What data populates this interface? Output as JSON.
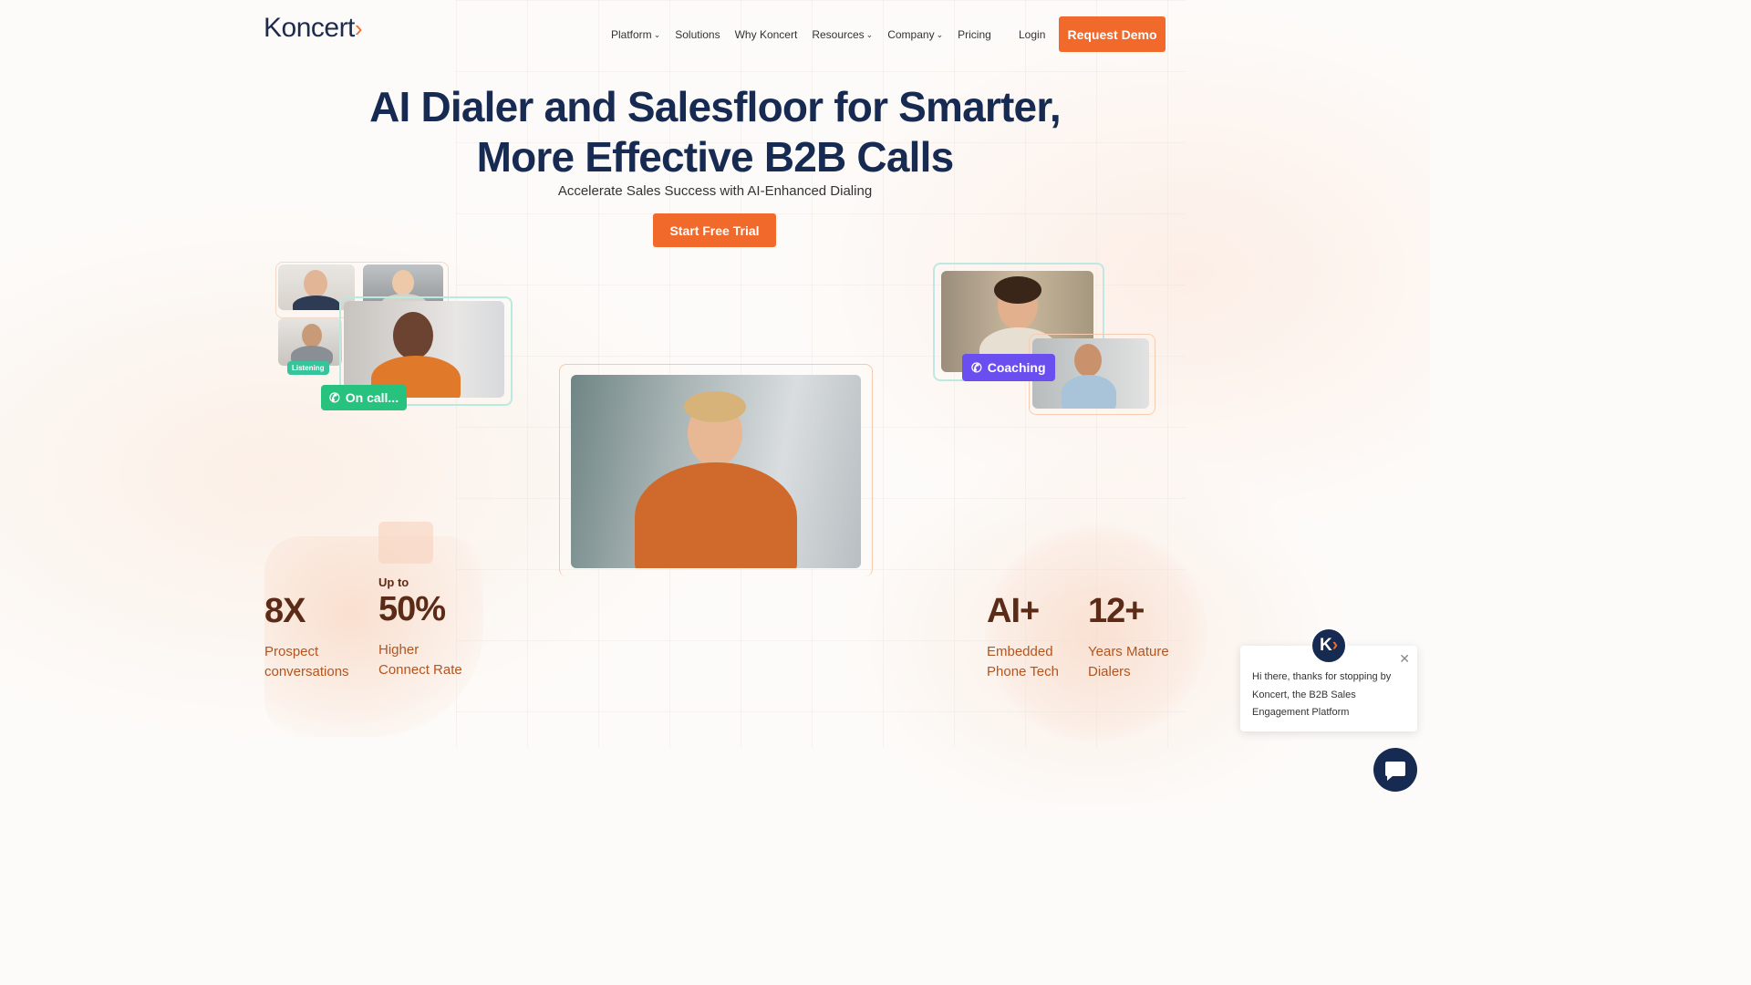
{
  "header": {
    "logo": "Koncert",
    "logo_mark": "›",
    "nav": [
      {
        "label": "Platform",
        "dropdown": true
      },
      {
        "label": "Solutions",
        "dropdown": false
      },
      {
        "label": "Why Koncert",
        "dropdown": false
      },
      {
        "label": "Resources",
        "dropdown": true
      },
      {
        "label": "Company",
        "dropdown": true
      },
      {
        "label": "Pricing",
        "dropdown": false
      }
    ],
    "login": "Login",
    "cta": "Request Demo"
  },
  "hero": {
    "title_line1": "AI Dialer and Salesfloor for Smarter,",
    "title_line2": "More Effective B2B Calls",
    "subtitle": "Accelerate Sales Success with AI-Enhanced Dialing",
    "cta": "Start Free Trial"
  },
  "visuals": {
    "left_badge": "On call...",
    "left_tag": "Listening",
    "right_badge": "Coaching"
  },
  "stats": [
    {
      "prefix": "",
      "value": "8X",
      "label_line1": "Prospect",
      "label_line2": "conversations"
    },
    {
      "prefix": "Up to",
      "value": "50%",
      "label_line1": "Higher",
      "label_line2": "Connect Rate"
    },
    {
      "prefix": "",
      "value": "AI+",
      "label_line1": "Embedded",
      "label_line2": "Phone Tech"
    },
    {
      "prefix": "",
      "value": "12+",
      "label_line1": "Years Mature",
      "label_line2": "Dialers"
    }
  ],
  "chat": {
    "message": "Hi there, thanks for stopping by Koncert, the B2B Sales Engagement Platform",
    "avatar_letter": "K",
    "avatar_mark": "›"
  },
  "colors": {
    "accent": "#f26a2b",
    "navy": "#162a52",
    "stat_text": "#5b2b17",
    "stat_label": "#b3541f",
    "green_badge": "#27c27e",
    "purple_badge": "#6b4ef0"
  },
  "icons": {
    "chat_close": "close-icon",
    "chat_launcher": "chat-bubble-icon",
    "phone": "phone-icon"
  }
}
